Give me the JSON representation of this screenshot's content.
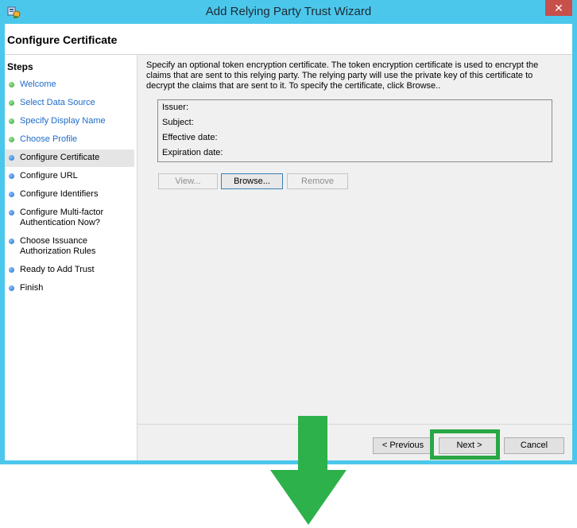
{
  "window": {
    "title": "Add Relying Party Trust Wizard",
    "close_glyph": "✕"
  },
  "header": {
    "title": "Configure Certificate"
  },
  "steps": {
    "title": "Steps",
    "items": [
      {
        "label": "Welcome",
        "state": "done"
      },
      {
        "label": "Select Data Source",
        "state": "done"
      },
      {
        "label": "Specify Display Name",
        "state": "done"
      },
      {
        "label": "Choose Profile",
        "state": "done"
      },
      {
        "label": "Configure Certificate",
        "state": "current"
      },
      {
        "label": "Configure URL",
        "state": "todo"
      },
      {
        "label": "Configure Identifiers",
        "state": "todo"
      },
      {
        "label": "Configure Multi-factor Authentication Now?",
        "state": "todo"
      },
      {
        "label": "Choose Issuance Authorization Rules",
        "state": "todo"
      },
      {
        "label": "Ready to Add Trust",
        "state": "todo"
      },
      {
        "label": "Finish",
        "state": "todo"
      }
    ]
  },
  "main": {
    "description": "Specify an optional token encryption certificate.  The token encryption certificate is used to encrypt the claims that are sent to this relying party.  The relying party will use the private key of this certificate to decrypt the claims that are sent to it.  To specify the certificate, click Browse..",
    "certificate": {
      "issuer_label": "Issuer:",
      "subject_label": "Subject:",
      "effective_label": "Effective date:",
      "expiration_label": "Expiration date:"
    },
    "buttons": {
      "view": "View...",
      "browse": "Browse...",
      "remove": "Remove"
    }
  },
  "footer": {
    "previous": "< Previous",
    "next": "Next >",
    "cancel": "Cancel"
  },
  "annotation": {
    "highlight_color": "#28a745",
    "arrow_color": "#2db14b"
  }
}
